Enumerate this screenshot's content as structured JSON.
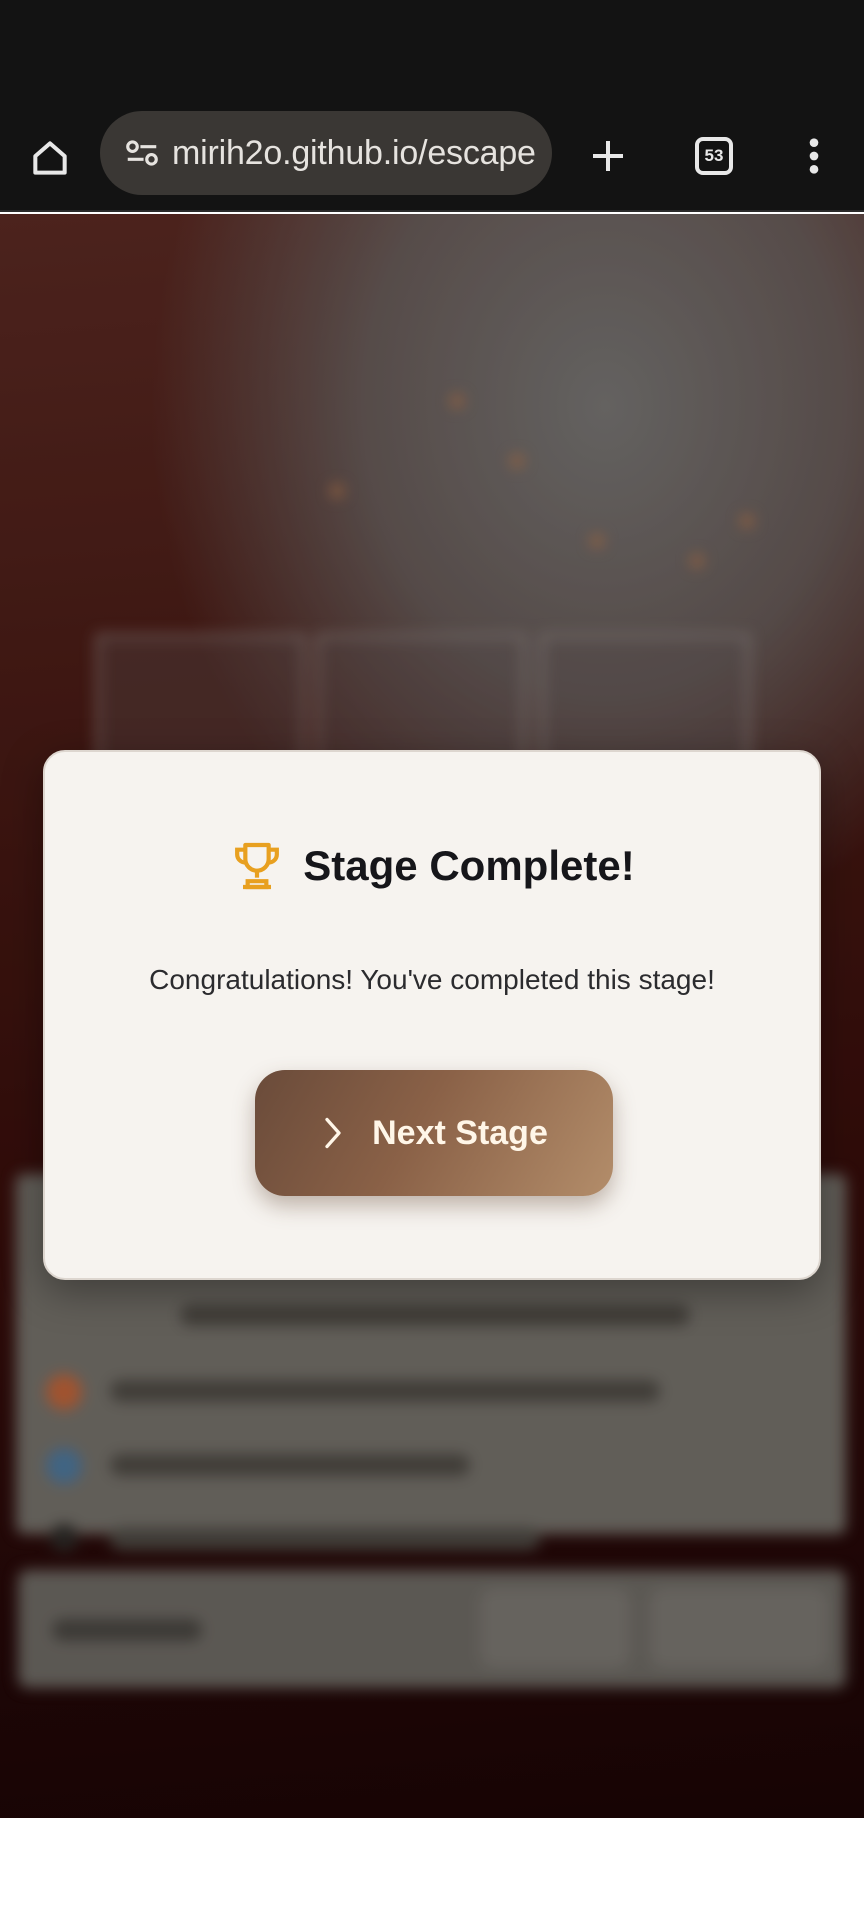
{
  "browser": {
    "url": "mirih2o.github.io/escape",
    "tab_count": "53",
    "icons": {
      "home": "home-icon",
      "site_info": "site-settings-icon",
      "new_tab": "plus-icon",
      "tabs": "tab-switcher-icon",
      "menu": "more-vert-icon"
    }
  },
  "modal": {
    "icon": "trophy-icon",
    "title": "Stage Complete!",
    "message": "Congratulations! You've completed this stage!",
    "button_label": "Next Stage",
    "button_icon": "chevron-right-icon"
  },
  "colors": {
    "modal_bg": "#f6f3ef",
    "trophy": "#e8a020",
    "button_start": "#6a4b3a",
    "button_end": "#b38d6a",
    "button_text": "#fff6e8"
  }
}
